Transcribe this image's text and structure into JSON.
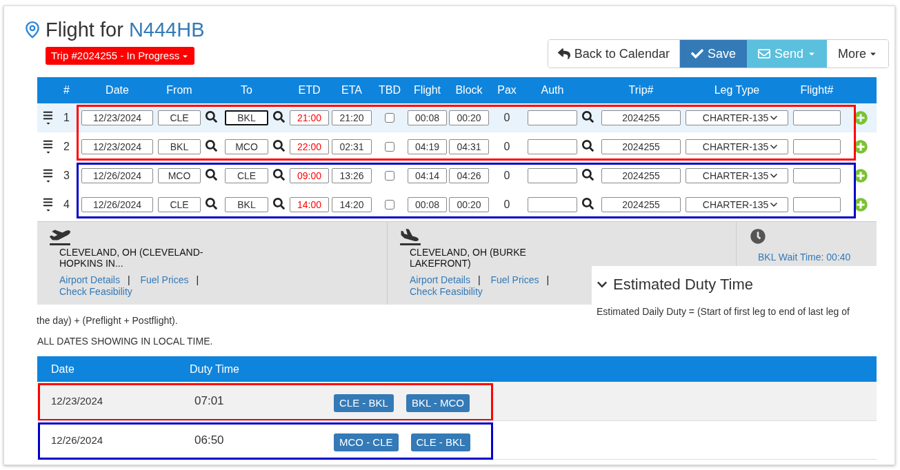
{
  "title": {
    "prefix": "Flight for",
    "tail": "N444HB"
  },
  "trip_status": "Trip #2024255 - In Progress",
  "actions": [
    {
      "kind": "back",
      "label": "Back to Calendar"
    },
    {
      "kind": "save",
      "label": "Save"
    },
    {
      "kind": "send",
      "label": "Send"
    },
    {
      "kind": "more",
      "label": "More"
    }
  ],
  "legs_table": {
    "columns": [
      "#",
      "Date",
      "From",
      "To",
      "ETD",
      "ETA",
      "TBD",
      "Flight",
      "Block",
      "Pax",
      "Auth",
      "Trip#",
      "Leg Type",
      "Flight#"
    ],
    "groups": [
      {
        "color": "#ff0000",
        "legs": [
          {
            "number": "1",
            "date": "12/23/2024",
            "from": "CLE",
            "to": "BKL",
            "to_focused": true,
            "etd": "21:00",
            "eta": "21:20",
            "tbd": false,
            "flight": "00:08",
            "block": "00:20",
            "pax": "0",
            "trip": "2024255",
            "leg_type": "CHARTER-135",
            "selected": true
          },
          {
            "number": "2",
            "date": "12/23/2024",
            "from": "BKL",
            "to": "MCO",
            "to_focused": false,
            "etd": "22:00",
            "eta": "02:31",
            "tbd": false,
            "flight": "04:19",
            "block": "04:31",
            "pax": "0",
            "trip": "2024255",
            "leg_type": "CHARTER-135",
            "selected": false
          }
        ]
      },
      {
        "color": "#0000c8",
        "legs": [
          {
            "number": "3",
            "date": "12/26/2024",
            "from": "MCO",
            "to": "CLE",
            "to_focused": false,
            "etd": "09:00",
            "eta": "13:26",
            "tbd": false,
            "flight": "04:14",
            "block": "04:26",
            "pax": "0",
            "trip": "2024255",
            "leg_type": "CHARTER-135",
            "selected": false
          },
          {
            "number": "4",
            "date": "12/26/2024",
            "from": "CLE",
            "to": "BKL",
            "to_focused": false,
            "etd": "14:00",
            "eta": "14:20",
            "tbd": false,
            "flight": "00:08",
            "block": "00:20",
            "pax": "0",
            "trip": "2024255",
            "leg_type": "CHARTER-135",
            "selected": false
          }
        ]
      }
    ]
  },
  "airport_info": {
    "separator": "|",
    "departure": {
      "name": "CLEVELAND, OH (CLEVELAND-HOPKINS IN...",
      "links": [
        "Airport Details",
        "Fuel Prices",
        "Check Feasibility"
      ]
    },
    "arrival": {
      "name": "CLEVELAND, OH (BURKE LAKEFRONT)",
      "links": [
        "Airport Details",
        "Fuel Prices",
        "Check Feasibility"
      ]
    },
    "wait_time": "BKL Wait Time: 00:40"
  },
  "duty": {
    "title": "Estimated Duty Time",
    "expanded": true,
    "description": [
      "Estimated Daily Duty = (Start of first leg to end of last leg of",
      "the day) + (Preflight + Postflight)."
    ],
    "note": "ALL DATES SHOWING IN LOCAL TIME.",
    "columns": [
      "Date",
      "Duty Time"
    ],
    "rows": [
      {
        "date": "12/23/2024",
        "duty_time": "07:01",
        "legs": [
          "CLE - BKL",
          "BKL - MCO"
        ],
        "color": "#ff0000"
      },
      {
        "date": "12/26/2024",
        "duty_time": "06:50",
        "legs": [
          "MCO - CLE",
          "CLE - BKL"
        ],
        "color": "#0000c8"
      }
    ]
  }
}
